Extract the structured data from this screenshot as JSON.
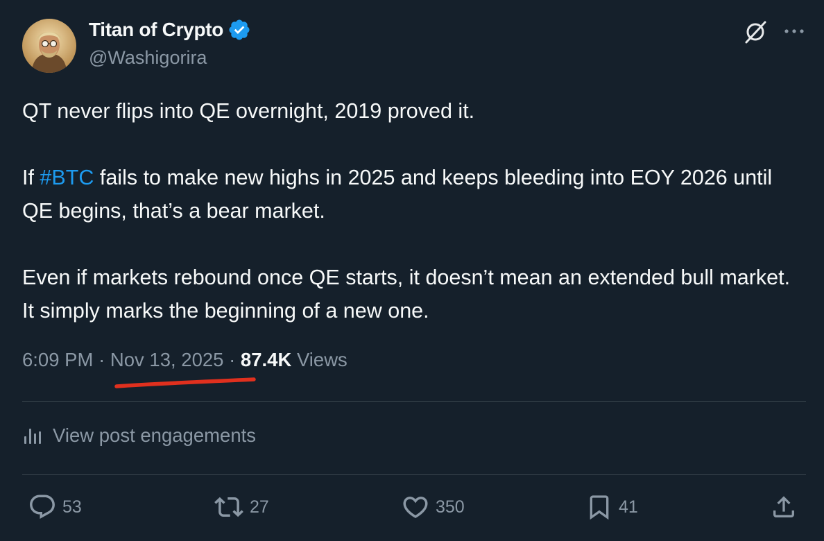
{
  "author": {
    "display_name": "Titan of Crypto",
    "handle": "@Washigorira",
    "verified": true
  },
  "tweet": {
    "line1": "QT never flips into QE overnight, 2019 proved it.",
    "p2_before": "If ",
    "hashtag": "#BTC",
    "p2_after": " fails to make new highs in 2025 and keeps bleeding into EOY 2026 until QE begins, that’s a bear market.",
    "p3": "Even if markets rebound once QE starts, it doesn’t mean an extended bull market. It simply marks the beginning of a new one."
  },
  "meta": {
    "time": "6:09 PM",
    "separator": "·",
    "date": "Nov 13, 2025",
    "views_count": "87.4K",
    "views_label": "Views"
  },
  "engagements_label": "View post engagements",
  "actions": {
    "replies": "53",
    "reposts": "27",
    "likes": "350",
    "bookmarks": "41"
  },
  "colors": {
    "background": "#15202b",
    "text": "#f7f9f9",
    "muted": "#8b98a5",
    "accent": "#1d9bf0",
    "annotation": "#e0301e"
  }
}
